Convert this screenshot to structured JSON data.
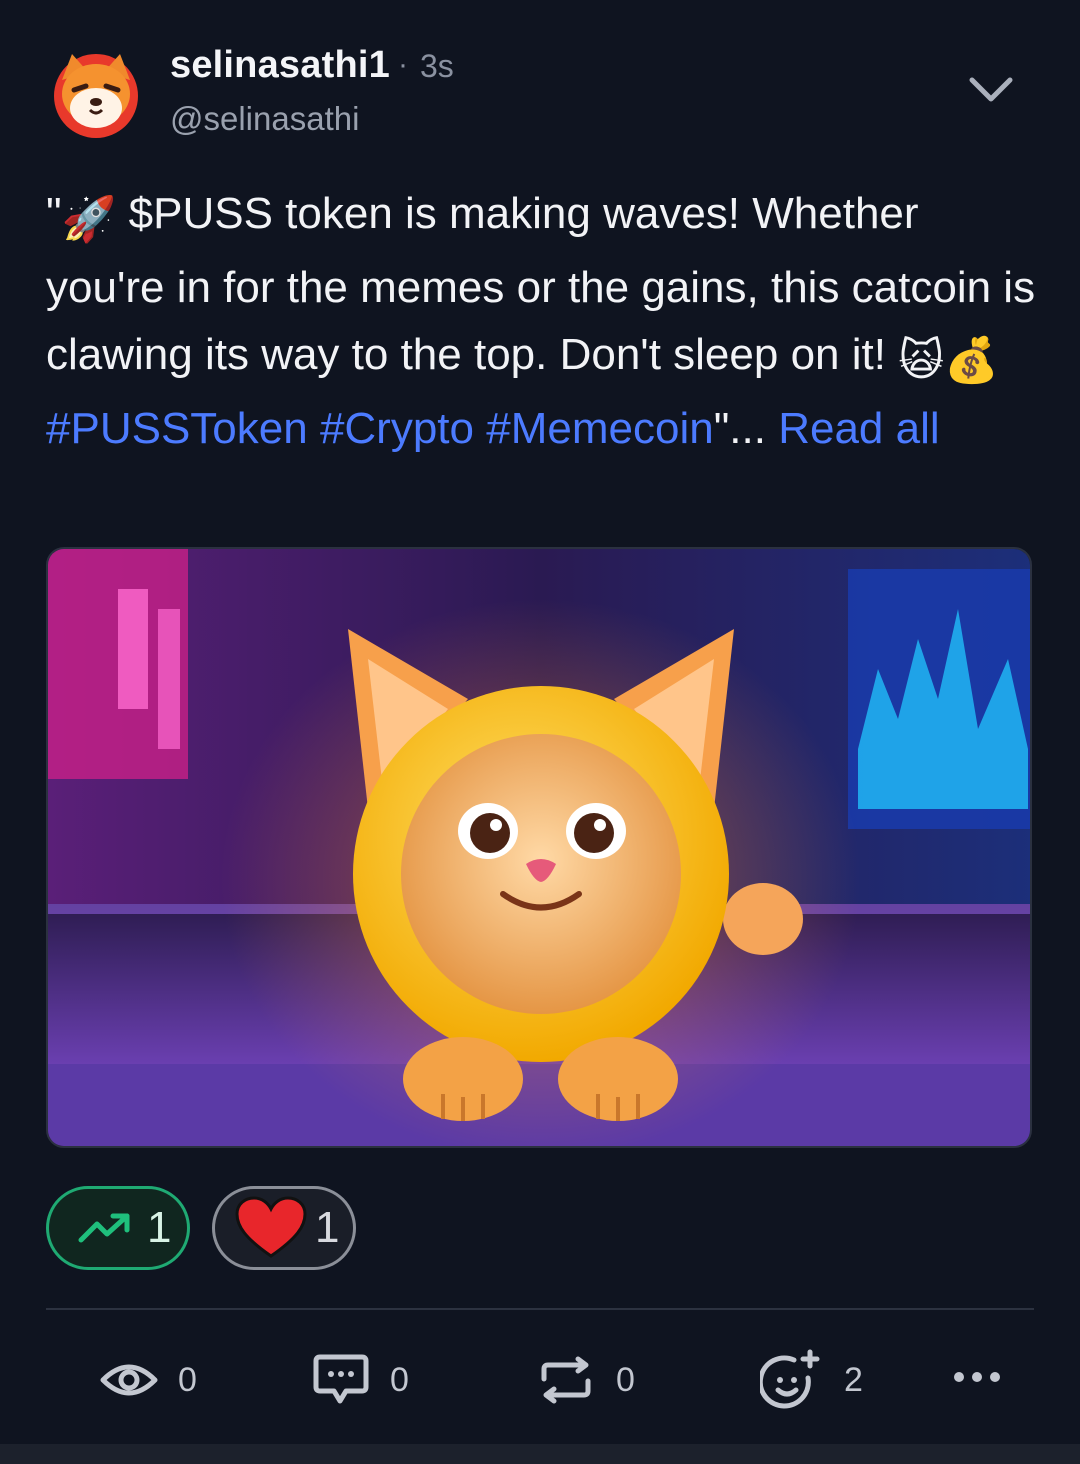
{
  "post": {
    "username": "selinasathi1",
    "separator": "·",
    "time": "3s",
    "handle": "@selinasathi",
    "text": {
      "open_quote": "\"",
      "rocket_emoji": "🚀",
      "body": " $PUSS token is making waves! Whether you're in for the memes or the gains, this catcoin is clawing its way to the top. Don't sleep on it! ",
      "cat_emoji": "🙀",
      "money_emoji": "💰",
      "hashtags": [
        "#PUSSToken",
        "#Crypto",
        "#Memecoin"
      ],
      "close_quote": "\"...",
      "read_all": "Read all"
    }
  },
  "reactions": {
    "trend_count": "1",
    "heart_count": "1"
  },
  "actions": {
    "views": "0",
    "comments": "0",
    "reposts": "0",
    "reactions": "2"
  },
  "colors": {
    "background": "#0f1420",
    "link": "#4c7bff",
    "trend_green": "#1faa73"
  },
  "icons": {
    "avatar": "shiba-inu-avatar",
    "more_menu": "chevron-down-icon",
    "trend": "trending-up-icon",
    "heart": "heart-icon",
    "views": "eye-icon",
    "comments": "comment-bubble-icon",
    "reposts": "repost-icon",
    "add_reaction": "add-reaction-smiley-icon",
    "more": "more-dots-icon"
  }
}
